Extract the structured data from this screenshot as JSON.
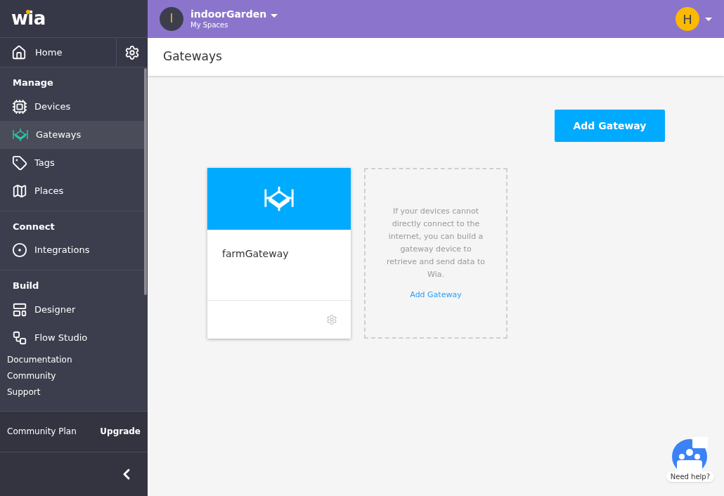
{
  "logo": "wia",
  "sidebar": {
    "home": {
      "label": "Home"
    },
    "sections": [
      {
        "heading": "Manage",
        "items": [
          {
            "label": "Devices",
            "selected": false
          },
          {
            "label": "Gateways",
            "selected": true
          },
          {
            "label": "Tags",
            "selected": false
          },
          {
            "label": "Places",
            "selected": false
          }
        ]
      },
      {
        "heading": "Connect",
        "items": [
          {
            "label": "Integrations",
            "selected": false
          }
        ]
      },
      {
        "heading": "Build",
        "items": [
          {
            "label": "Designer",
            "selected": false
          },
          {
            "label": "Flow Studio",
            "selected": false
          }
        ]
      }
    ],
    "links": [
      "Documentation",
      "Community",
      "Support"
    ],
    "plan": {
      "label": "Community Plan",
      "upgrade": "Upgrade"
    }
  },
  "header": {
    "space_initial": "I",
    "space_name": "indoorGarden",
    "space_subtitle": "My Spaces",
    "user_initial": "H"
  },
  "page_title": "Gateways",
  "add_button": "Add Gateway",
  "gateways": [
    {
      "name": "farmGateway"
    }
  ],
  "empty_card": {
    "text": "If your devices cannot directly connect to the internet, you can build a gateway device to retrieve and send data to Wia.",
    "link": "Add Gateway"
  },
  "help": "Need help?"
}
